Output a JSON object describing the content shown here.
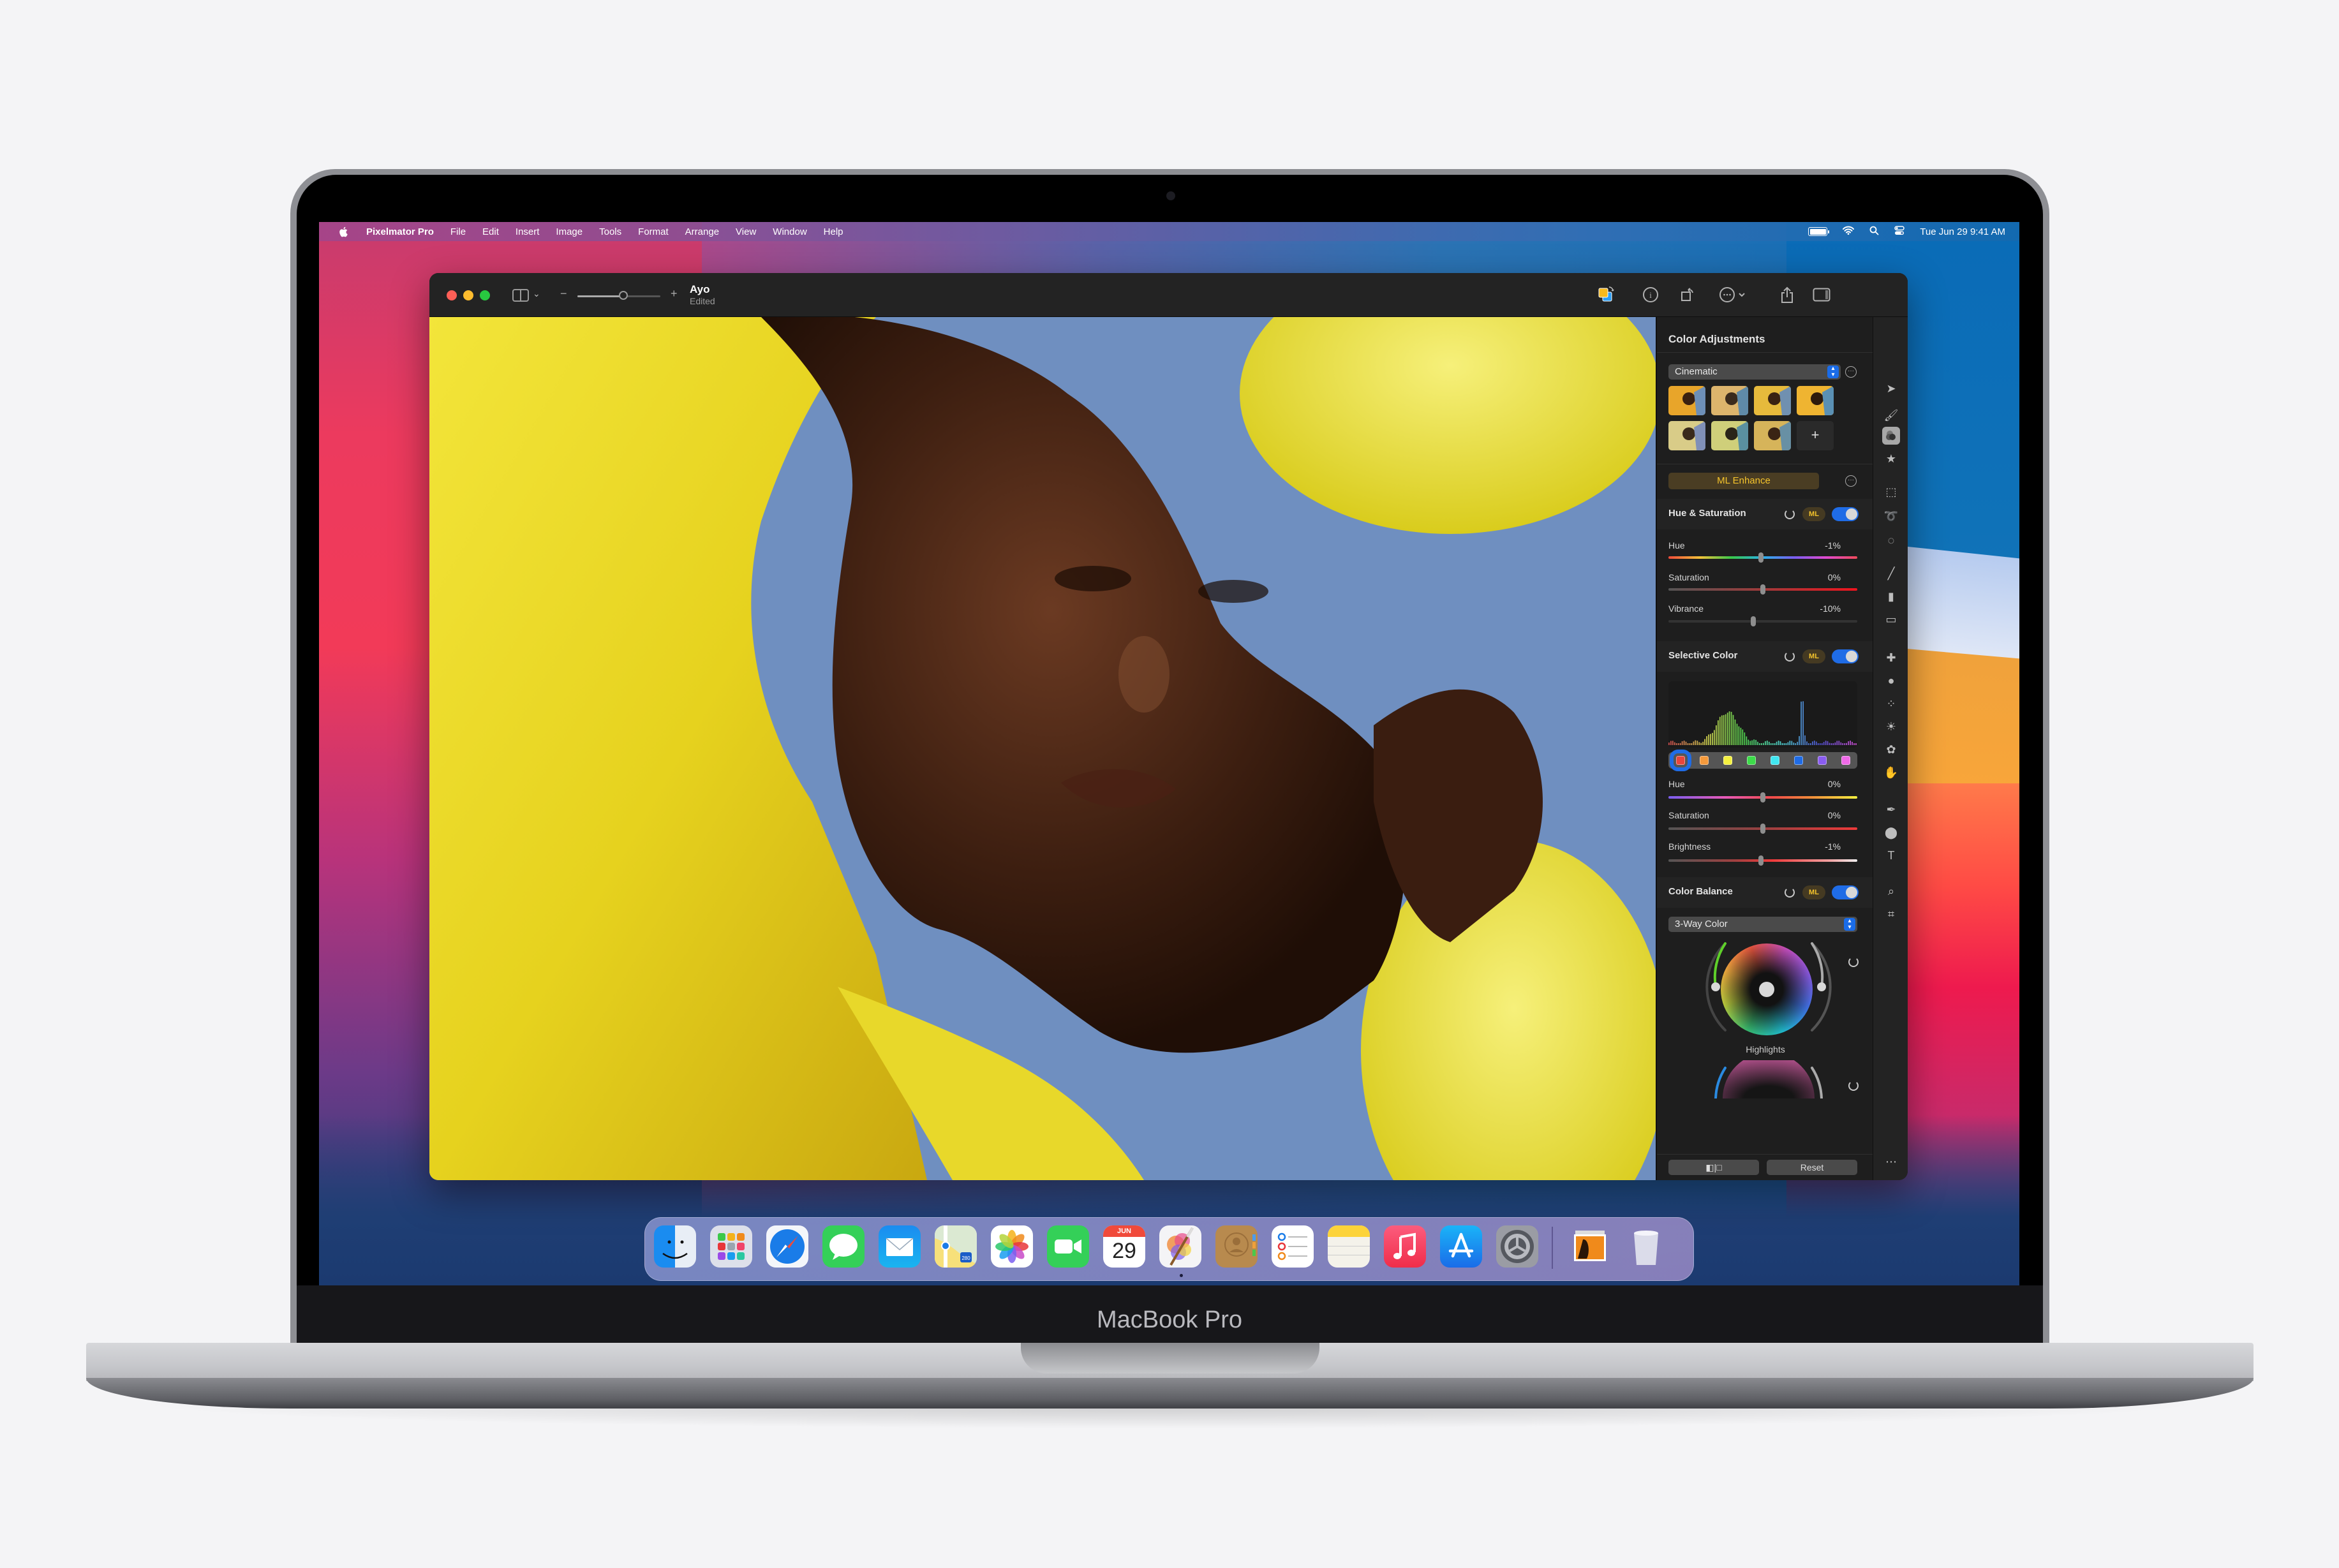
{
  "device": {
    "label": "MacBook Pro"
  },
  "menubar": {
    "apple_icon": "apple-logo-icon",
    "app_name": "Pixelmator Pro",
    "menus": [
      "File",
      "Edit",
      "Insert",
      "Image",
      "Tools",
      "Format",
      "Arrange",
      "View",
      "Window",
      "Help"
    ],
    "status_icons": [
      "battery-icon",
      "wifi-icon",
      "search-icon",
      "control-center-icon"
    ],
    "clock": "Tue Jun 29  9:41 AM"
  },
  "window": {
    "document_title": "Ayo",
    "document_subtitle": "Edited",
    "zoom_minus": "−",
    "zoom_plus": "+",
    "zoom_level": 0.55,
    "toolbar_icons": [
      "layers-swap-icon",
      "info-icon",
      "rotate-icon",
      "more-options-icon",
      "share-icon",
      "sidebar-right-icon"
    ]
  },
  "panel": {
    "title": "Color Adjustments",
    "preset_select": "Cinematic",
    "preset_thumbnails": 7,
    "add_preset": "+",
    "ml_enhance": "ML Enhance",
    "hue_saturation": {
      "title": "Hue & Saturation",
      "ml_badge": "ML",
      "enabled": true,
      "sliders": [
        {
          "label": "Hue",
          "value": "-1%",
          "position": 0.49
        },
        {
          "label": "Saturation",
          "value": "0%",
          "position": 0.5
        },
        {
          "label": "Vibrance",
          "value": "-10%",
          "position": 0.45
        }
      ]
    },
    "selective_color": {
      "title": "Selective Color",
      "ml_badge": "ML",
      "enabled": true,
      "swatches": [
        "#e8453c",
        "#f59a3c",
        "#f4f040",
        "#3ddc4a",
        "#40e6f0",
        "#1f6ce6",
        "#8a5cf0",
        "#f06ae8"
      ],
      "selected_swatch": 0,
      "sliders": [
        {
          "label": "Hue",
          "value": "0%",
          "position": 0.5
        },
        {
          "label": "Saturation",
          "value": "0%",
          "position": 0.5
        },
        {
          "label": "Brightness",
          "value": "-1%",
          "position": 0.49
        }
      ]
    },
    "color_balance": {
      "title": "Color Balance",
      "ml_badge": "ML",
      "enabled": true,
      "mode_select": "3-Way Color",
      "wheel_label": "Highlights"
    },
    "bottom_buttons": {
      "compare": "◧|□",
      "reset": "Reset"
    }
  },
  "tools": [
    "arrange-tool-icon",
    "style-tool-icon",
    "color-adjust-tool-icon",
    "effects-tool-icon",
    "rect-select-tool-icon",
    "lasso-select-tool-icon",
    "quick-select-tool-icon",
    "paint-tool-icon",
    "fill-tool-icon",
    "erase-tool-icon",
    "repair-tool-icon",
    "clone-tool-icon",
    "blur-tool-icon",
    "light-tool-icon",
    "color-tool-icon",
    "warp-tool-icon",
    "pen-tool-icon",
    "shape-tool-icon",
    "type-tool-icon",
    "zoom-tool-icon",
    "crop-tool-icon",
    "more-tools-icon"
  ],
  "dock": {
    "apps": [
      "Finder",
      "Launchpad",
      "Safari",
      "Messages",
      "Mail",
      "Maps",
      "Photos",
      "FaceTime",
      "Calendar",
      "Pixelmator Pro",
      "Contacts",
      "Reminders",
      "Notes",
      "Music",
      "App Store",
      "System Preferences"
    ],
    "calendar_month": "JUN",
    "calendar_day": "29",
    "maps_shield": "280",
    "stacks": [
      "Photos stack",
      "Trash"
    ]
  }
}
